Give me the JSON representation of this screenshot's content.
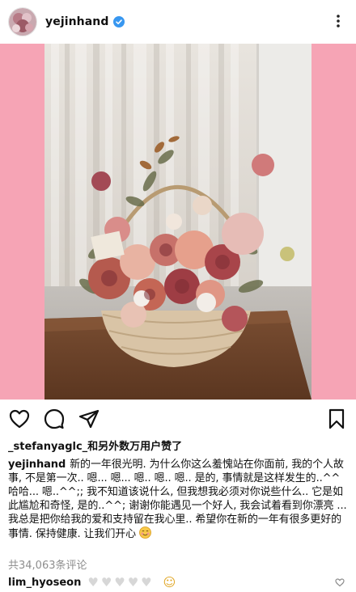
{
  "post": {
    "username": "yejinhand",
    "likes_text": "_stefanyaglc_和另外数万用户赞了",
    "caption_user": "yejinhand",
    "caption_text": "新的一年很光明. 为什么你这么羞愧站在你面前, 我的个人故事, 不是第一次.. 嗯... 嗯... 嗯.. 嗯.. 嗯.. 是的, 事情就是这样发生的..^^哈哈... 嗯..^^;; 我不知道该说什么, 但我想我必须对你说些什么.. 它是如此尴尬和奇怪, 是的..^^; 谢谢你能遇见一个好人, 我会试着看到你漂亮 ... 我总是把你给我的爱和支持留在我心里.. 希望你在新的一年有很多更好的事情. 保持健康. 让我们开心",
    "caption_emoji": "smiling-face",
    "comments_count": "共34,063条评论",
    "comment": {
      "username": "lim_hyoseon",
      "hearts": [
        "♥",
        "♥",
        "♥",
        "♥",
        "♥"
      ],
      "emoji": "☺"
    }
  },
  "colors": {
    "frame": "#f6a4b5",
    "verified": "#3897f0",
    "muted": "#8e8e8e"
  },
  "icons": [
    "more-vertical-icon",
    "verified-icon",
    "heart-icon",
    "comment-icon",
    "share-icon",
    "bookmark-icon"
  ]
}
